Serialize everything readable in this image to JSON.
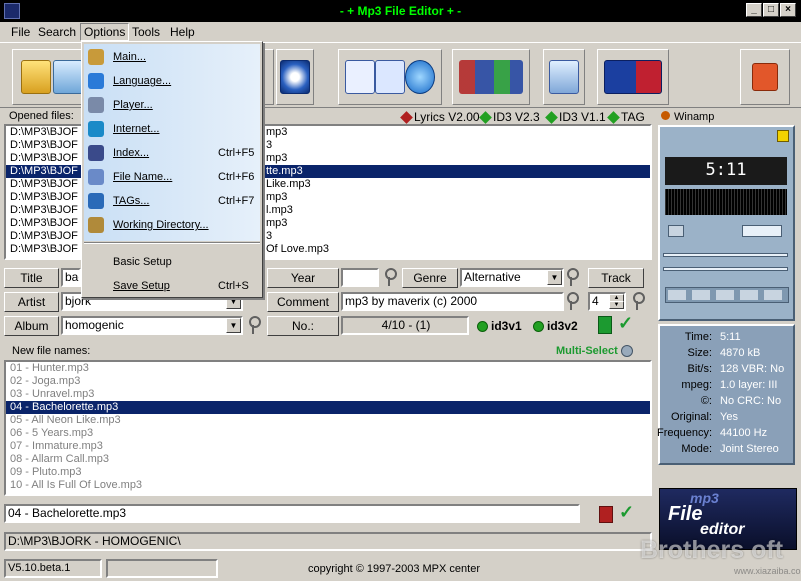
{
  "window": {
    "title": "- + Mp3 File Editor + -",
    "minimize": "_",
    "maximize": "□",
    "close": "×"
  },
  "menubar": {
    "file": "File",
    "search": "Search",
    "options": "Options",
    "tools": "Tools",
    "help": "Help"
  },
  "options_menu": {
    "items": [
      {
        "label": "Main...",
        "shortcut": "",
        "icon": "main-icon"
      },
      {
        "label": "Language...",
        "shortcut": "",
        "icon": "globe-icon"
      },
      {
        "label": "Player...",
        "shortcut": "",
        "icon": "disc-icon"
      },
      {
        "label": "Internet...",
        "shortcut": "",
        "icon": "internet-icon"
      },
      {
        "label": "Index...",
        "shortcut": "Ctrl+F5",
        "icon": "music-note-icon"
      },
      {
        "label": "File Name...",
        "shortcut": "Ctrl+F6",
        "icon": "file-name-icon"
      },
      {
        "label": "TAGs...",
        "shortcut": "Ctrl+F7",
        "icon": "tag-icon"
      },
      {
        "label": "Working Directory...",
        "shortcut": "",
        "icon": "folder-icon"
      }
    ],
    "basic_setup": "Basic Setup",
    "save_setup": "Save Setup",
    "save_setup_shortcut": "Ctrl+S"
  },
  "opened_files": {
    "label": "Opened files:",
    "indicators": {
      "lyrics": "Lyrics V2.00",
      "id3v23": "ID3 V2.3",
      "id3v11": "ID3 V1.1",
      "tag": "TAG"
    },
    "prefix": "D:\\MP3\\BJOF",
    "rows": [
      {
        "visible_tail": "mp3",
        "selected": false
      },
      {
        "visible_tail": "3",
        "selected": false
      },
      {
        "visible_tail": "mp3",
        "selected": false
      },
      {
        "visible_tail": "tte.mp3",
        "selected": true
      },
      {
        "visible_tail": "Like.mp3",
        "selected": false
      },
      {
        "visible_tail": "mp3",
        "selected": false
      },
      {
        "visible_tail": "l.mp3",
        "selected": false
      },
      {
        "visible_tail": "mp3",
        "selected": false
      },
      {
        "visible_tail": "3",
        "selected": false
      },
      {
        "visible_tail": "Of Love.mp3",
        "selected": false
      }
    ]
  },
  "tag_editor": {
    "title_label": "Title",
    "title_value": "bac",
    "artist_label": "Artist",
    "artist_value": "bjork",
    "album_label": "Album",
    "album_value": "homogenic",
    "year_label": "Year",
    "year_value": "",
    "genre_label": "Genre",
    "genre_value": "Alternative",
    "track_label": "Track",
    "track_value": "4",
    "comment_label": "Comment",
    "comment_value": "mp3 by maverix (c) 2000",
    "no_label": "No.:",
    "no_value": "4/10 - (1)",
    "id3v1": "id3v1",
    "id3v2": "id3v2"
  },
  "new_names": {
    "label": "New file names:",
    "multi_select": "Multi-Select",
    "rows": [
      "01 - Hunter.mp3",
      "02 - Joga.mp3",
      "03 - Unravel.mp3",
      "04 - Bachelorette.mp3",
      "05 - All Neon Like.mp3",
      "06 - 5 Years.mp3",
      "07 - Immature.mp3",
      "08 - Allarm Call.mp3",
      "09 - Pluto.mp3",
      "10 - All Is Full Of Love.mp3"
    ],
    "selected_index": 3,
    "edit_value": "04 - Bachelorette.mp3"
  },
  "path": "D:\\MP3\\BJORK - HOMOGENIC\\",
  "status": {
    "version": "V5.10.beta.1",
    "copyright": "copyright © 1997-2003  MPX center"
  },
  "winamp": {
    "label": "Winamp",
    "time": "5:11",
    "info": [
      {
        "k": "Time:",
        "v": "5:11"
      },
      {
        "k": "Size:",
        "v": "4870 kB"
      },
      {
        "k": "Bit/s:",
        "v": "128  VBR: No"
      },
      {
        "k": "mpeg:",
        "v": "1.0   layer: III"
      },
      {
        "k": "©:",
        "v": "No    CRC: No"
      },
      {
        "k": "Original:",
        "v": "Yes"
      },
      {
        "k": "Frequency:",
        "v": "44100 Hz"
      },
      {
        "k": "Mode:",
        "v": "Joint Stereo"
      }
    ]
  },
  "logo": {
    "line1": "mp3",
    "line2": "File",
    "line3": "editor",
    "watermark": "Brothers oft",
    "site": "www.xiazaiba.com"
  },
  "colors": {
    "title_green": "#00ff00",
    "selection": "#0a246a",
    "accent_red": "#b02020",
    "accent_green": "#22a022"
  }
}
